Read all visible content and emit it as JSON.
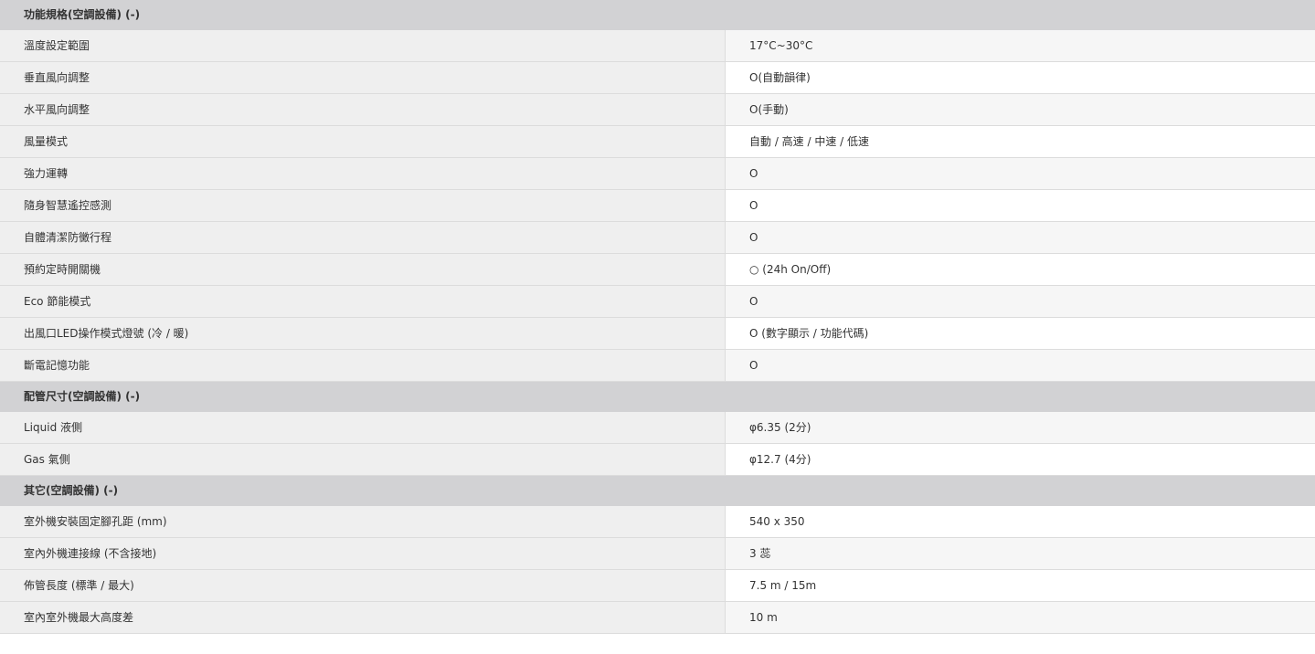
{
  "sections": [
    {
      "title": "功能規格(空調設備) (-)",
      "rows": [
        {
          "label": "溫度設定範圍",
          "value": "17°C~30°C"
        },
        {
          "label": "垂直風向調整",
          "value": "O(自動韻律)"
        },
        {
          "label": "水平風向調整",
          "value": "O(手動)"
        },
        {
          "label": "風量模式",
          "value": "自動 / 高速 / 中速 / 低速"
        },
        {
          "label": "強力運轉",
          "value": "O"
        },
        {
          "label": "隨身智慧遙控感測",
          "value": "O"
        },
        {
          "label": "自體清潔防黴行程",
          "value": "O"
        },
        {
          "label": "預約定時開關機",
          "value": "○ (24h On/Off)"
        },
        {
          "label": "Eco 節能模式",
          "value": "O"
        },
        {
          "label": "出風口LED操作模式燈號 (冷 / 暖)",
          "value": "O (數字顯示 / 功能代碼)"
        },
        {
          "label": "斷電記憶功能",
          "value": "O"
        }
      ]
    },
    {
      "title": "配管尺寸(空調設備) (-)",
      "rows": [
        {
          "label": "Liquid 液側",
          "value": "φ6.35 (2分)"
        },
        {
          "label": "Gas 氣側",
          "value": "φ12.7 (4分)"
        }
      ]
    },
    {
      "title": "其它(空調設備) (-)",
      "rows": [
        {
          "label": "室外機安裝固定腳孔距 (mm)",
          "value": "540 x 350"
        },
        {
          "label": "室內外機連接線 (不含接地)",
          "value": "3 蕊"
        },
        {
          "label": "佈管長度 (標準 / 最大)",
          "value": "7.5 m / 15m"
        },
        {
          "label": "室內室外機最大高度差",
          "value": "10 m"
        }
      ]
    }
  ]
}
